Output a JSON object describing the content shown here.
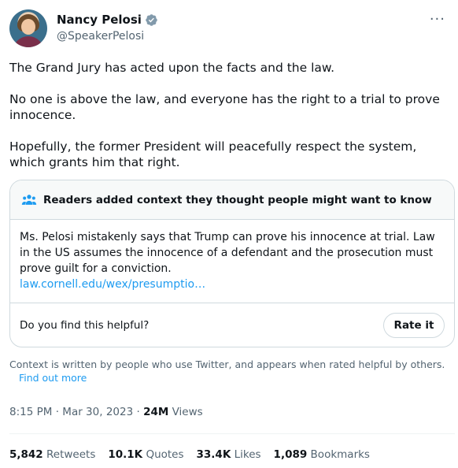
{
  "author": {
    "name": "Nancy Pelosi",
    "handle": "@SpeakerPelosi",
    "verified_color": "#829aab"
  },
  "more_label": "···",
  "tweet": {
    "paragraphs": [
      "The Grand Jury has acted upon the facts and the law.",
      "No one is above the law, and everyone has the right to a trial to prove innocence.",
      "Hopefully, the former President will peacefully respect the system, which grants him that right."
    ]
  },
  "community_note": {
    "title": "Readers added context they thought people might want to know",
    "body": "Ms. Pelosi mistakenly says that Trump can prove his innocence at trial. Law in the US assumes the innocence of a defendant and the prosecution must prove guilt for a conviction.",
    "link": "law.cornell.edu/wex/presumptio…",
    "helpful_prompt": "Do you find this helpful?",
    "rate_label": "Rate it",
    "icon_color": "#1d9bf0"
  },
  "context_note": {
    "text": "Context is written by people who use Twitter, and appears when rated helpful by others.",
    "link": "Find out more"
  },
  "meta": {
    "time": "8:15 PM",
    "dot": "·",
    "date": "Mar 30, 2023",
    "views_count": "24M",
    "views_label": "Views"
  },
  "stats": {
    "retweets_count": "5,842",
    "retweets_label": "Retweets",
    "quotes_count": "10.1K",
    "quotes_label": "Quotes",
    "likes_count": "33.4K",
    "likes_label": "Likes",
    "bookmarks_count": "1,089",
    "bookmarks_label": "Bookmarks"
  },
  "colors": {
    "accent": "#1d9bf0",
    "text": "#0f1419",
    "muted": "#536471",
    "border": "#cfd9de"
  }
}
